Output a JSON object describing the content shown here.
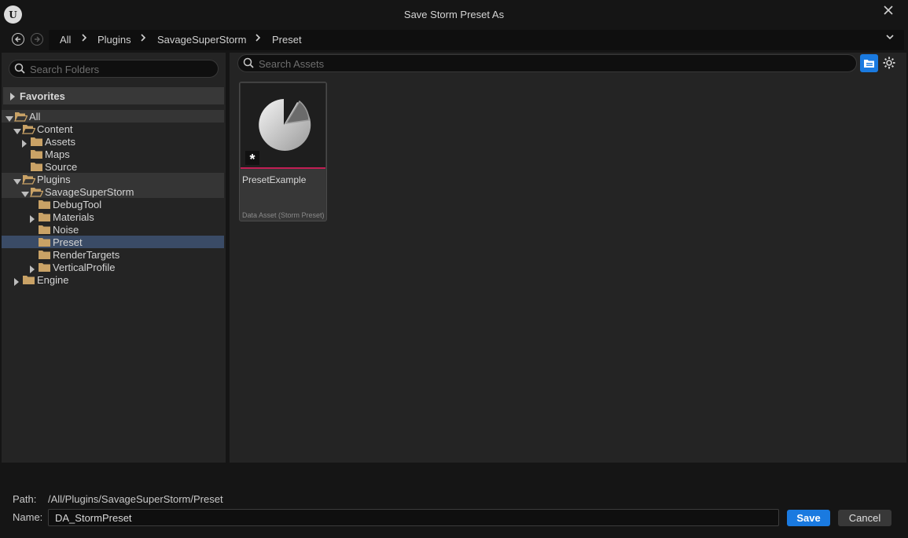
{
  "window": {
    "title": "Save Storm Preset As",
    "logo_text": "U",
    "close_glyph": "✕"
  },
  "nav": {
    "back_glyph": "‹",
    "forward_glyph": "›",
    "breadcrumbs": [
      "All",
      "Plugins",
      "SavageSuperStorm",
      "Preset"
    ],
    "separator": "›",
    "dropdown_glyph": "⌄"
  },
  "folders": {
    "search_placeholder": "Search Folders",
    "favorites_label": "Favorites",
    "tree": [
      {
        "label": "All",
        "depth": 0,
        "expanded": true,
        "has_children": true,
        "open_folder": true,
        "highlight": "light"
      },
      {
        "label": "Content",
        "depth": 1,
        "expanded": true,
        "has_children": true,
        "open_folder": true,
        "highlight": "none"
      },
      {
        "label": "Assets",
        "depth": 2,
        "expanded": false,
        "has_children": true,
        "open_folder": false,
        "highlight": "none"
      },
      {
        "label": "Maps",
        "depth": 2,
        "expanded": false,
        "has_children": false,
        "open_folder": false,
        "highlight": "none"
      },
      {
        "label": "Source",
        "depth": 2,
        "expanded": false,
        "has_children": false,
        "open_folder": false,
        "highlight": "none"
      },
      {
        "label": "Plugins",
        "depth": 1,
        "expanded": true,
        "has_children": true,
        "open_folder": true,
        "highlight": "light"
      },
      {
        "label": "SavageSuperStorm",
        "depth": 2,
        "expanded": true,
        "has_children": true,
        "open_folder": true,
        "highlight": "light"
      },
      {
        "label": "DebugTool",
        "depth": 3,
        "expanded": false,
        "has_children": false,
        "open_folder": false,
        "highlight": "none"
      },
      {
        "label": "Materials",
        "depth": 3,
        "expanded": false,
        "has_children": true,
        "open_folder": false,
        "highlight": "none"
      },
      {
        "label": "Noise",
        "depth": 3,
        "expanded": false,
        "has_children": false,
        "open_folder": false,
        "highlight": "none"
      },
      {
        "label": "Preset",
        "depth": 3,
        "expanded": false,
        "has_children": false,
        "open_folder": false,
        "highlight": "blue"
      },
      {
        "label": "RenderTargets",
        "depth": 3,
        "expanded": false,
        "has_children": false,
        "open_folder": false,
        "highlight": "none"
      },
      {
        "label": "VerticalProfile",
        "depth": 3,
        "expanded": false,
        "has_children": true,
        "open_folder": false,
        "highlight": "none"
      },
      {
        "label": "Engine",
        "depth": 1,
        "expanded": false,
        "has_children": true,
        "open_folder": false,
        "highlight": "none"
      }
    ]
  },
  "assets": {
    "search_placeholder": "Search Assets",
    "items": [
      {
        "name": "PresetExample",
        "type": "Data Asset (Storm Preset)",
        "badge": "*",
        "accent": "#c21f55"
      }
    ]
  },
  "footer": {
    "path_label": "Path:",
    "path_value": "/All/Plugins/SavageSuperStorm/Preset",
    "name_label": "Name:",
    "name_value": "DA_StormPreset",
    "save_label": "Save",
    "cancel_label": "Cancel"
  },
  "colors": {
    "accent_blue": "#1a7ae0",
    "selection_blue": "#3a4b66",
    "asset_accent": "#c21f55",
    "folder": "#c9a266"
  }
}
